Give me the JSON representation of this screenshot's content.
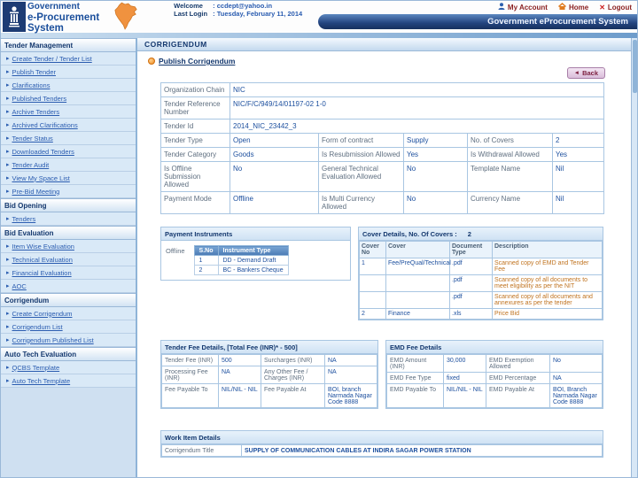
{
  "colors": {
    "navy": "#17376e",
    "accent_orange": "#ef8b1f",
    "link_blue": "#2a5cb0",
    "maroon": "#8b2222",
    "value_blue": "#1c4f9e",
    "description_orange": "#c0731f"
  },
  "header": {
    "logo_line1": "Government",
    "logo_line2": "e-Procurement",
    "logo_line3": "System",
    "welcome_label": "Welcome",
    "welcome_value": ": ccdept@yahoo.in",
    "last_login_label": "Last Login",
    "last_login_value": ": Tuesday, February 11, 2014",
    "my_account": "My Account",
    "home": "Home",
    "logout": "Logout",
    "banner": "Government eProcurement System"
  },
  "sidebar": {
    "sections": [
      {
        "title": "Tender Management",
        "items": [
          "Create Tender / Tender List",
          "Publish Tender",
          "Clarifications",
          "Published Tenders",
          "Archive Tenders",
          "Archived Clarifications",
          "Tender Status",
          "Downloaded Tenders",
          "Tender Audit",
          "View My Space List",
          "Pre-Bid Meeting"
        ]
      },
      {
        "title": "Bid Opening",
        "items": [
          "Tenders"
        ]
      },
      {
        "title": "Bid Evaluation",
        "items": [
          "Item Wise Evaluation",
          "Technical Evaluation",
          "Financial Evaluation",
          "AOC"
        ]
      },
      {
        "title": "Corrigendum",
        "items": [
          "Create Corrigendum",
          "Corrigendum List",
          "Corrigendum Published List"
        ]
      },
      {
        "title": "Auto Tech Evaluation",
        "items": [
          "QCBS Template",
          "Auto Tech Template"
        ]
      }
    ]
  },
  "main": {
    "page_title": "CORRIGENDUM",
    "publish_title": "Publish Corrigendum",
    "back_label": "Back",
    "details_rows": [
      {
        "l1": "Organization Chain",
        "v1": "NIC"
      },
      {
        "l1": "Tender Reference Number",
        "v1": "NIC/F/C/949/14/01197-02 1-0"
      },
      {
        "l1": "Tender Id",
        "v1": "2014_NIC_23442_3"
      },
      {
        "l1": "Tender Type",
        "v1": "Open",
        "l2": "Form of contract",
        "v2": "Supply",
        "l3": "No. of Covers",
        "v3": "2"
      },
      {
        "l1": "Tender Category",
        "v1": "Goods",
        "l2": "Is Resubmission Allowed",
        "v2": "Yes",
        "l3": "Is Withdrawal Allowed",
        "v3": "Yes"
      },
      {
        "l1": "Is Offline Submission Allowed",
        "v1": "No",
        "l2": "General Technical Evaluation Allowed",
        "v2": "No",
        "l3": "Template Name",
        "v3": "Nil"
      },
      {
        "l1": "Payment Mode",
        "v1": "Offline",
        "l2": "Is Multi Currency Allowed",
        "v2": "No",
        "l3": "Currency Name",
        "v3": "Nil"
      }
    ],
    "payment_instruments": {
      "title": "Payment Instruments",
      "mode": "Offline",
      "col_sno": "S.No",
      "col_type": "Instrument Type",
      "rows": [
        {
          "sno": "1",
          "type": "DD - Demand Draft"
        },
        {
          "sno": "2",
          "type": "BC - Bankers Cheque"
        }
      ]
    },
    "cover_details": {
      "title": "Cover Details, No. Of Covers :",
      "covers_count": "2",
      "col_no": "Cover No",
      "col_cover": "Cover",
      "col_doc": "Document Type",
      "col_desc": "Description",
      "rows": [
        {
          "no": "1",
          "cover": "Fee/PreQual/Technical",
          "doc": ".pdf",
          "desc": "Scanned copy of EMD and Tender Fee"
        },
        {
          "no": "",
          "cover": "",
          "doc": ".pdf",
          "desc": "Scanned copy of all documents to meet eligibility as per the NIT"
        },
        {
          "no": "",
          "cover": "",
          "doc": ".pdf",
          "desc": "Scanned copy of all documents and annexures as per the tender"
        },
        {
          "no": "2",
          "cover": "Finance",
          "doc": ".xls",
          "desc": "Price Bid"
        }
      ]
    },
    "tender_fee": {
      "title": "Tender Fee Details, [Total Fee (INR)* - 500]",
      "rows": [
        {
          "l1": "Tender Fee (INR)",
          "v1": "500",
          "l2": "Surcharges (INR)",
          "v2": "NA"
        },
        {
          "l1": "Processing Fee (INR)",
          "v1": "NA",
          "l2": "Any Other Fee / Charges (INR)",
          "v2": "NA"
        },
        {
          "l1": "Fee Payable To",
          "v1": "NIL/NIL - NIL",
          "l2": "Fee Payable At",
          "v2": "BOI, branch Narmada Nagar Code 8888"
        }
      ]
    },
    "emd_fee": {
      "title": "EMD Fee Details",
      "rows": [
        {
          "l1": "EMD Amount (INR)",
          "v1": "30,000",
          "l2": "EMD Exemption Allowed",
          "v2": "No"
        },
        {
          "l1": "EMD Fee Type",
          "v1": "fixed",
          "l2": "EMD Percentage",
          "v2": "NA"
        },
        {
          "l1": "EMD Payable To",
          "v1": "NIL/NIL - NIL",
          "l2": "EMD Payable At",
          "v2": "BOI, Branch Narmada Nagar Code 8888"
        }
      ]
    },
    "work_item": {
      "title": "Work Item Details",
      "label": "Corrigendum Title",
      "value": "SUPPLY OF COMMUNICATION CABLES AT INDIRA SAGAR POWER STATION"
    }
  }
}
